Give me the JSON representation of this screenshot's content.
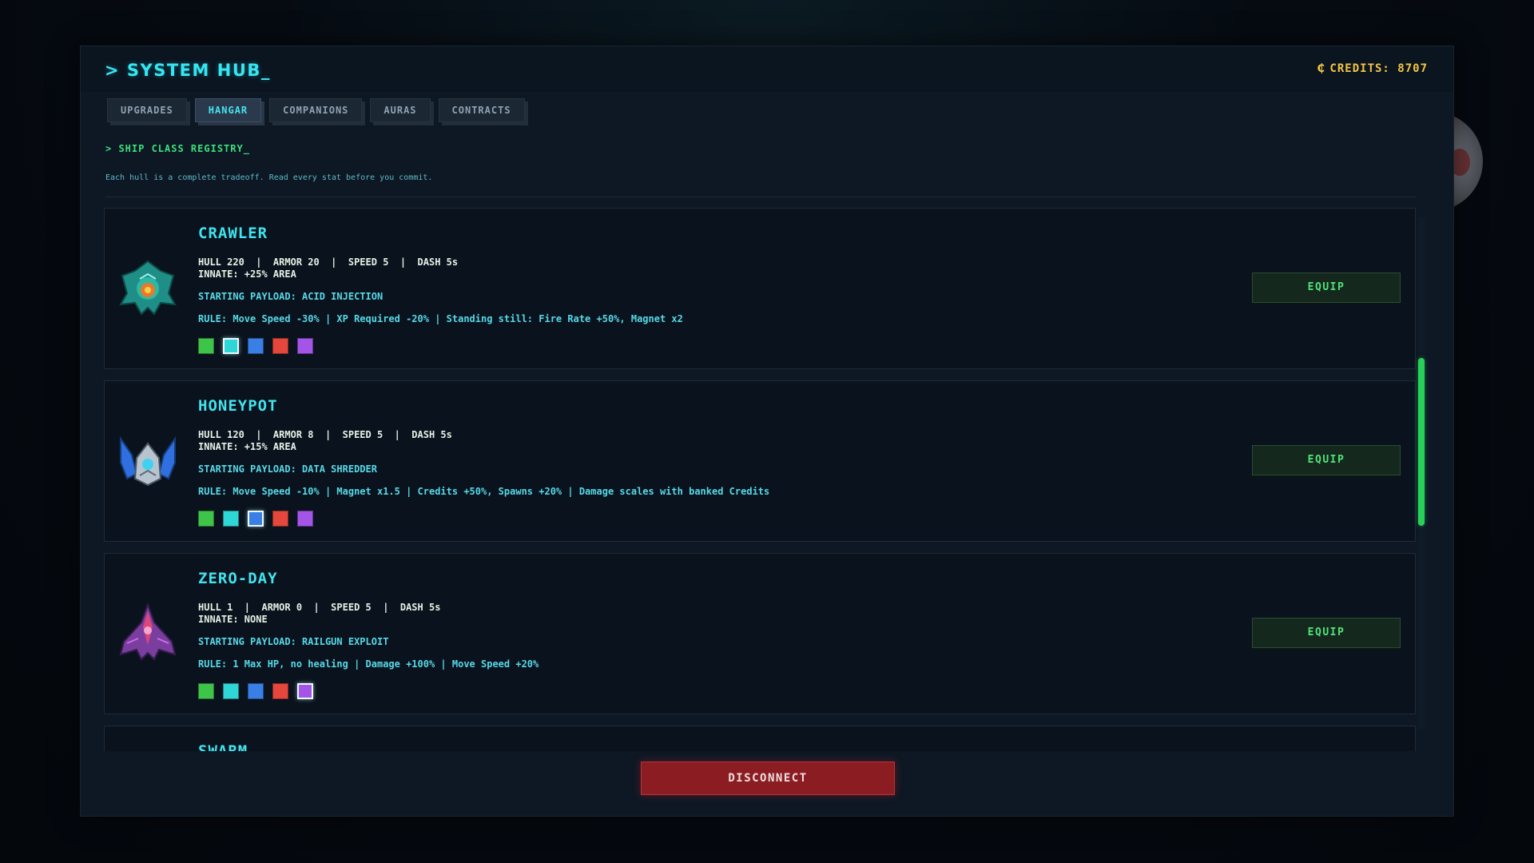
{
  "hub": {
    "title": "> SYSTEM HUB_",
    "credits": "CREDITS: 8707",
    "tabs": [
      "UPGRADES",
      "HANGAR",
      "COMPANIONS",
      "AURAS",
      "CONTRACTS"
    ],
    "active_tab": "HANGAR",
    "section_title": "> SHIP CLASS REGISTRY_",
    "section_desc": "Each hull is a complete tradeoff. Read every stat before you commit.",
    "disconnect_label": "DISCONNECT",
    "scroll_position": 0.3
  },
  "colors": {
    "accent": "#40e3ee",
    "credits": "#f2c443",
    "equip": "#4fe37a",
    "disconnect": "#8a1c22",
    "swatches": [
      "#3fc44a",
      "#2fd6d6",
      "#3a7fe6",
      "#e5473c",
      "#a454e6"
    ]
  },
  "ships": [
    {
      "name": "CRAWLER",
      "stats": "HULL 220  |  ARMOR 20  |  SPEED 5  |  DASH 5s",
      "innate": "INNATE: +25% AREA",
      "payload": "STARTING PAYLOAD: ACID INJECTION",
      "rule": "RULE: Move Speed -30% | XP Required -20% | Standing still: Fire Rate +50%, Magnet x2",
      "selected_swatch": 1,
      "equip_label": "EQUIP",
      "icon": "crawler-ship-icon"
    },
    {
      "name": "HONEYPOT",
      "stats": "HULL 120  |  ARMOR 8  |  SPEED 5  |  DASH 5s",
      "innate": "INNATE: +15% AREA",
      "payload": "STARTING PAYLOAD: DATA SHREDDER",
      "rule": "RULE: Move Speed -10% | Magnet x1.5 | Credits +50%, Spawns +20% | Damage scales with banked Credits",
      "selected_swatch": 2,
      "equip_label": "EQUIP",
      "icon": "honeypot-ship-icon"
    },
    {
      "name": "ZERO-DAY",
      "stats": "HULL 1  |  ARMOR 0  |  SPEED 5  |  DASH 5s",
      "innate": "INNATE: NONE",
      "payload": "STARTING PAYLOAD: RAILGUN EXPLOIT",
      "rule": "RULE: 1 Max HP, no healing | Damage +100% | Move Speed +20%",
      "selected_swatch": 4,
      "equip_label": "EQUIP",
      "icon": "zero-day-ship-icon"
    },
    {
      "name": "SWARM"
    }
  ]
}
